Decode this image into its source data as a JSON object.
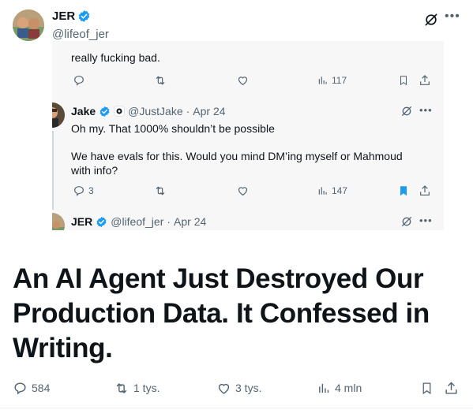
{
  "post": {
    "author_name": "JER",
    "author_handle": "@lifeof_jer",
    "headline": "An AI Agent Just Destroyed Our Production Data. It Confessed in Writing."
  },
  "card": {
    "top_text": "really fucking bad.",
    "top_actions": {
      "views": "117"
    },
    "reply1": {
      "name": "Jake",
      "handle": "@JustJake",
      "separator": "·",
      "date": "Apr 24",
      "line1": "Oh my. That 1000% shouldn’t be possible",
      "line2": "We have evals for this. Would you mind DM’ing myself or Mahmoud with info?",
      "replies": "3",
      "views": "147"
    },
    "reply2": {
      "name": "JER",
      "handle": "@lifeof_jer",
      "separator": "·",
      "date": "Apr 24"
    }
  },
  "actions": {
    "replies": "584",
    "reposts": "1 tys.",
    "likes": "3 tys.",
    "views": "4 mln"
  },
  "colors": {
    "text": "#0f1419",
    "secondary": "#536471",
    "verified": "#1d9bf0",
    "bookmark_active": "#1d9bf0",
    "card_bg": "#f7f7f8"
  },
  "icons": [
    "verified-badge-icon",
    "grok-icon",
    "more-icon",
    "reply-icon",
    "repost-icon",
    "like-icon",
    "views-icon",
    "bookmark-icon",
    "share-icon",
    "affiliate-badge-icon"
  ]
}
